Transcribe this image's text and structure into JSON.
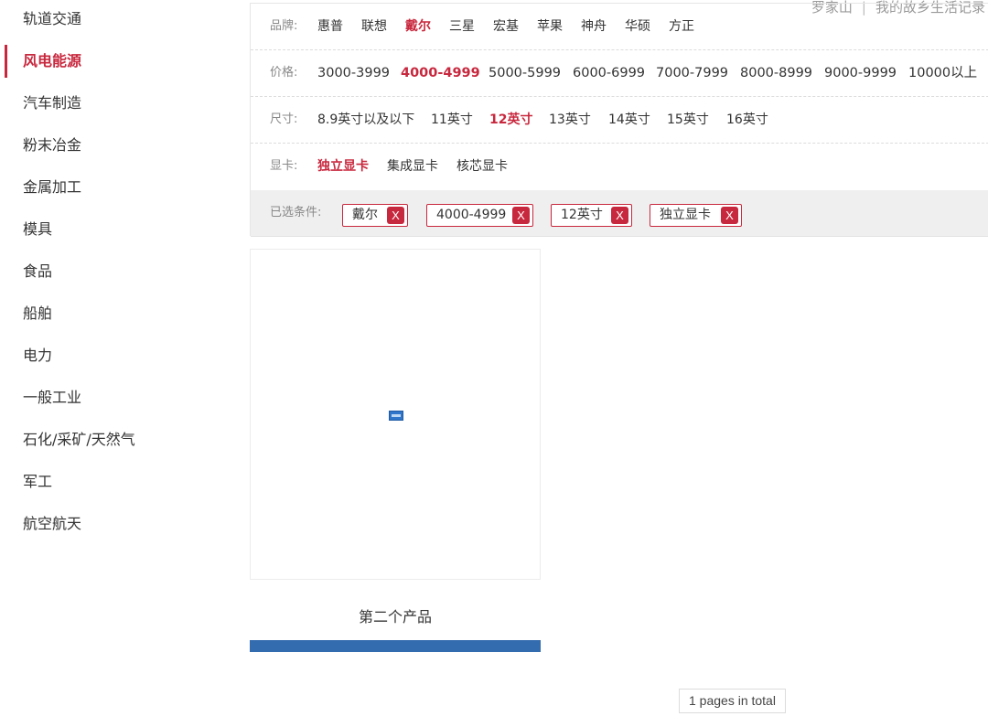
{
  "sidebar": {
    "items": [
      {
        "label": "轨道交通",
        "active": false
      },
      {
        "label": "风电能源",
        "active": true
      },
      {
        "label": "汽车制造",
        "active": false
      },
      {
        "label": "粉末冶金",
        "active": false
      },
      {
        "label": "金属加工",
        "active": false
      },
      {
        "label": "模具",
        "active": false
      },
      {
        "label": "食品",
        "active": false
      },
      {
        "label": "船舶",
        "active": false
      },
      {
        "label": "电力",
        "active": false
      },
      {
        "label": "一般工业",
        "active": false
      },
      {
        "label": "石化/采矿/天然气",
        "active": false
      },
      {
        "label": "军工",
        "active": false
      },
      {
        "label": "航空航天",
        "active": false
      }
    ]
  },
  "topright": {
    "user": "罗家山",
    "separator": "|",
    "blog": "我的故乡生活记录"
  },
  "filters": {
    "brand": {
      "label": "品牌:",
      "options": [
        "惠普",
        "联想",
        "戴尔",
        "三星",
        "宏基",
        "苹果",
        "神舟",
        "华硕",
        "方正"
      ],
      "selected": "戴尔"
    },
    "price": {
      "label": "价格:",
      "options": [
        "3000-3999",
        "4000-4999",
        "5000-5999",
        "6000-6999",
        "7000-7999",
        "8000-8999",
        "9000-9999",
        "10000以上"
      ],
      "selected": "4000-4999"
    },
    "size": {
      "label": "尺寸:",
      "options": [
        "8.9英寸以及以下",
        "11英寸",
        "12英寸",
        "13英寸",
        "14英寸",
        "15英寸",
        "16英寸"
      ],
      "selected": "12英寸"
    },
    "gpu": {
      "label": "显卡:",
      "options": [
        "独立显卡",
        "集成显卡",
        "核芯显卡"
      ],
      "selected": "独立显卡"
    }
  },
  "selected_conditions": {
    "label": "已选条件:",
    "chips": [
      {
        "text": "戴尔",
        "remove": "X"
      },
      {
        "text": "4000-4999",
        "remove": "X"
      },
      {
        "text": "12英寸",
        "remove": "X"
      },
      {
        "text": "独立显卡",
        "remove": "X"
      }
    ]
  },
  "product": {
    "name": "第二个产品"
  },
  "pager": {
    "text": "1 pages in total"
  },
  "colors": {
    "accent": "#c8283e",
    "product_bar": "#336caf"
  }
}
